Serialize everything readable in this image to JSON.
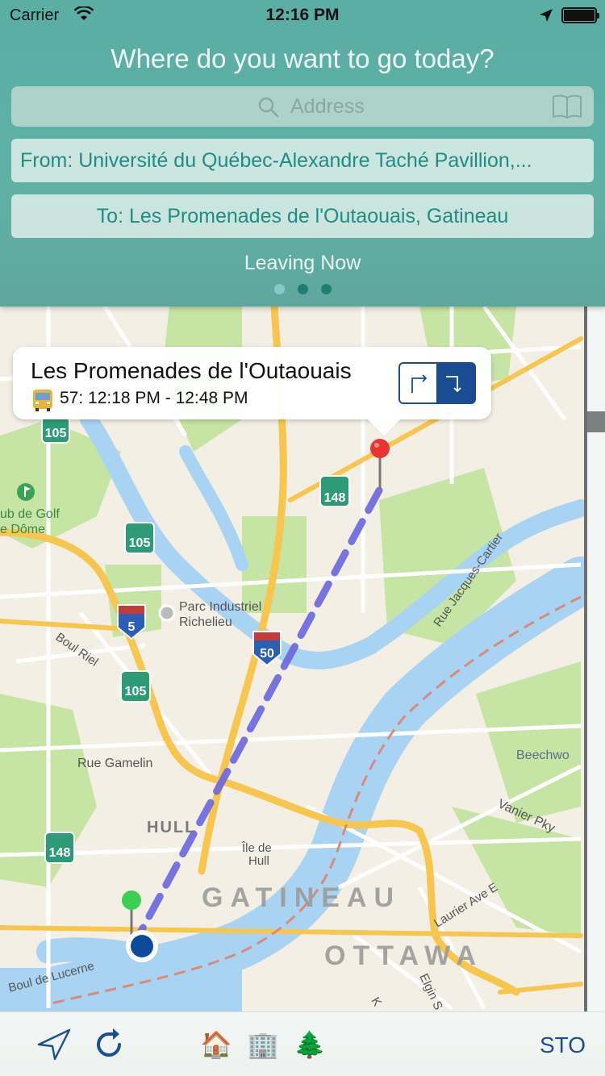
{
  "status_bar": {
    "carrier": "Carrier",
    "time": "12:16 PM"
  },
  "planner": {
    "prompt": "Where do you want to go today?",
    "search_placeholder": "Address",
    "from": "From: Université du Québec-Alexandre Taché Pavillion,...",
    "to": "To: Les Promenades de l'Outaouais, Gatineau",
    "leaving": "Leaving Now",
    "page_count": 3,
    "active_page": 1
  },
  "callout": {
    "title": "Les Promenades de l'Outaouais",
    "route_times": "57: 12:18 PM - 12:48 PM",
    "icon": "bus-icon"
  },
  "map": {
    "labels": {
      "golf_1": "ub de Golf",
      "golf_2": "e Dôme",
      "parc_1": "Parc Industriel",
      "parc_2": "Richelieu",
      "boul_riel": "Boul Riel",
      "rue_gamelin": "Rue Gamelin",
      "hull": "HULL",
      "ile_1": "Île de",
      "ile_2": "Hull",
      "gatineau": "GATINEAU",
      "ottawa": "OTTAWA",
      "boul_lucerne": "Boul de Lucerne",
      "rue_jacques": "Rue Jacques-Cartier",
      "beechwood": "Beechwo",
      "vanier": "Vanier Pky",
      "laurier": "Laurier Ave E",
      "elgin": "Elgin S",
      "ottawa_k": "K"
    },
    "shields": {
      "r105_a": "105",
      "r105_b": "105",
      "r105_c": "105",
      "r148_a": "148",
      "r148_b": "148",
      "a5": "5",
      "a50": "50"
    },
    "colors": {
      "water": "#a9d3f2",
      "park": "#c6e4a3",
      "major_road": "#f7c64e",
      "route_line": "#6a66e0"
    }
  },
  "toolbar": {
    "locate_icon": "location-arrow-icon",
    "refresh_icon": "refresh-icon",
    "home_emoji": "🏠",
    "office_emoji": "🏢",
    "tree_emoji": "🌲",
    "agency": "STO"
  }
}
